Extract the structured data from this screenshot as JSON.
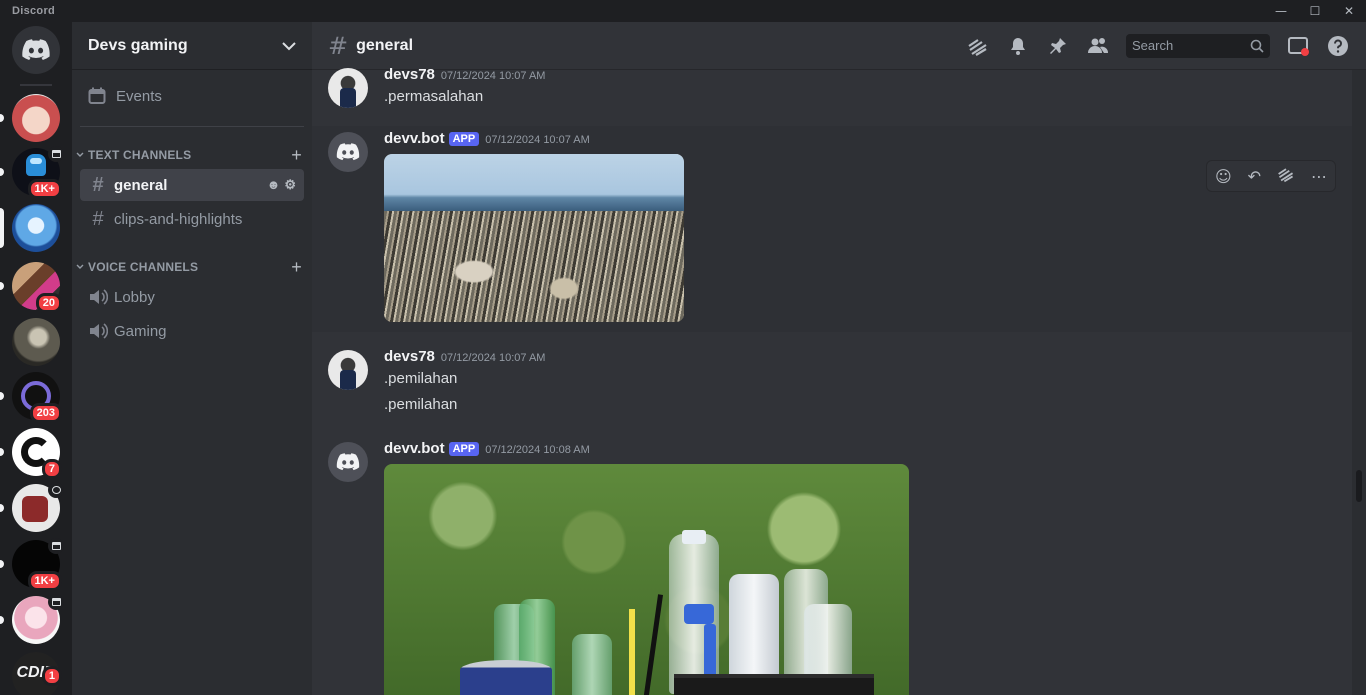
{
  "app": {
    "brand": "Discord"
  },
  "window_controls": [
    "—",
    "☐",
    "✕"
  ],
  "servers": [
    {
      "name": "discord-home",
      "badge": ""
    },
    {
      "name": "server-wolf",
      "badge": ""
    },
    {
      "name": "server-among",
      "badge": "1K+"
    },
    {
      "name": "server-blue-anime",
      "badge": ""
    },
    {
      "name": "server-pixel",
      "badge": "20"
    },
    {
      "name": "server-horse",
      "badge": ""
    },
    {
      "name": "server-hp",
      "badge": "203"
    },
    {
      "name": "server-g",
      "badge": "7"
    },
    {
      "name": "server-red",
      "badge": ""
    },
    {
      "name": "server-dark",
      "badge": "1K+"
    },
    {
      "name": "server-pink-anime",
      "badge": ""
    },
    {
      "name": "server-cdid",
      "badge": "1",
      "label": "CDID"
    }
  ],
  "guild": {
    "name": "Devs gaming",
    "events_label": "Events",
    "text_category": "TEXT CHANNELS",
    "voice_category": "VOICE CHANNELS",
    "text_channels": [
      {
        "label": "general",
        "active": true
      },
      {
        "label": "clips-and-highlights",
        "active": false
      }
    ],
    "voice_channels": [
      {
        "label": "Lobby"
      },
      {
        "label": "Gaming"
      }
    ]
  },
  "channel": {
    "title": "general",
    "search_placeholder": "Search"
  },
  "messages": [
    {
      "author": "devs78",
      "app": false,
      "timestamp": "07/12/2024 10:07 AM",
      "lines": [
        ".permasalahan"
      ]
    },
    {
      "author": "devv.bot",
      "app": true,
      "app_label": "APP",
      "timestamp": "07/12/2024 10:07 AM",
      "lines": []
    },
    {
      "author": "devs78",
      "app": false,
      "timestamp": "07/12/2024 10:07 AM",
      "lines": [
        ".pemilahan",
        ".pemilahan"
      ]
    },
    {
      "author": "devv.bot",
      "app": true,
      "app_label": "APP",
      "timestamp": "07/12/2024 10:08 AM",
      "lines": []
    }
  ],
  "colors": {
    "accent": "#5865f2",
    "badge": "#f23f43",
    "bg_main": "#313338",
    "bg_sidebar": "#2b2d31",
    "bg_servers": "#1e1f22"
  }
}
